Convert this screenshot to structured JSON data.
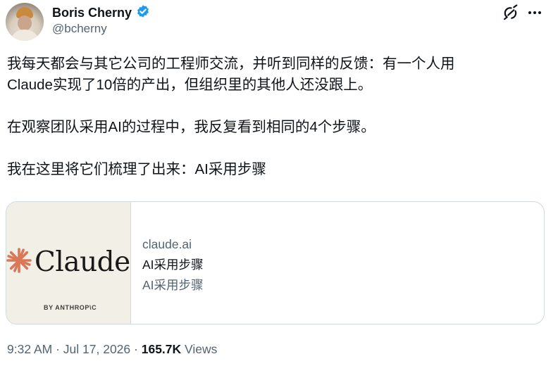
{
  "author": {
    "display_name": "Boris Cherny",
    "handle": "@bcherny",
    "verified_badge_icon": "verified-badge-icon"
  },
  "header_actions": {
    "grok_icon": "grok-icon",
    "more_icon": "more-options-icon"
  },
  "tweet": {
    "lines": [
      "我每天都会与其它公司的工程师交流，并听到同样的反馈：有一个人用",
      "Claude实现了10倍的产出，但组织里的其他人还没跟上。",
      "在观察团队采用AI的过程中，我反复看到相同的4个步骤。",
      "我在这里将它们梳理了出来：AI采用步骤"
    ]
  },
  "link_card": {
    "image_logo_text": "Claude",
    "image_byline": "BY ANTHROP\\C",
    "domain": "claude.ai",
    "title": "AI采用步骤",
    "description": "AI采用步骤"
  },
  "meta": {
    "time": "9:32 AM",
    "separator": "·",
    "date": "Jul 17, 2026",
    "views_count": "165.7K",
    "views_label": "Views"
  },
  "colors": {
    "verified_blue": "#1d9bf0",
    "claude_orange": "#d97757",
    "secondary_text": "#536471",
    "primary_text": "#0f1419",
    "card_border": "#cfd9de"
  }
}
